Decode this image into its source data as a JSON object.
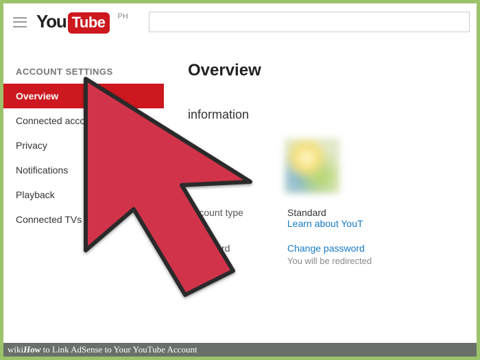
{
  "header": {
    "logo_you": "You",
    "logo_tube": "Tube",
    "country": "PH",
    "search_placeholder": ""
  },
  "sidebar": {
    "heading": "ACCOUNT SETTINGS",
    "items": [
      {
        "label": "Overview",
        "active": true
      },
      {
        "label": "Connected accounts",
        "active": false
      },
      {
        "label": "Privacy",
        "active": false
      },
      {
        "label": "Notifications",
        "active": false
      },
      {
        "label": "Playback",
        "active": false
      },
      {
        "label": "Connected TVs",
        "active": false
      }
    ]
  },
  "main": {
    "title": "Overview",
    "section_title": "information",
    "fields": {
      "name_label": "",
      "account_type_label": "Account type",
      "account_type_value": "Standard",
      "account_type_link": "Learn about YouT",
      "password_label": "Password",
      "password_link": "Change password",
      "password_hint": "You will be redirected"
    }
  },
  "caption": {
    "brand_wiki": "wiki",
    "brand_how": "How",
    "tail": " to Link AdSense to Your YouTube Account"
  }
}
